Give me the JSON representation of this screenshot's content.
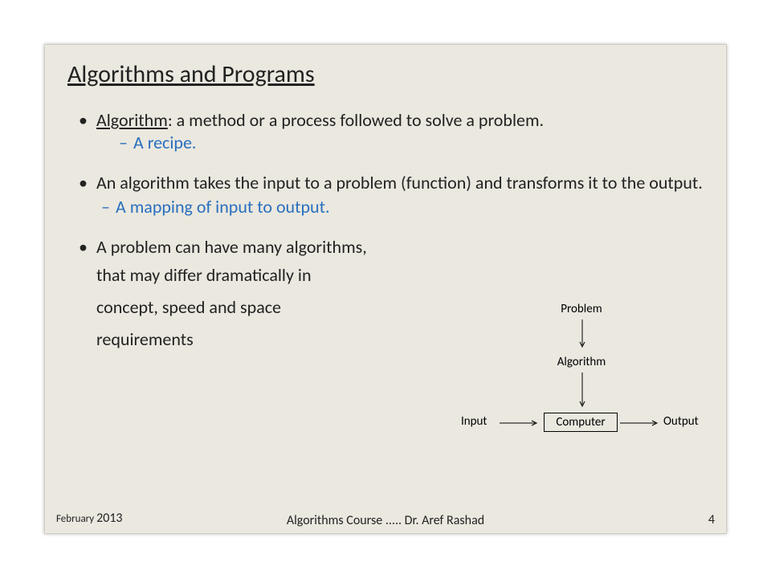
{
  "title": "Algorithms and Programs",
  "bullets": {
    "b1_term": "Algorithm",
    "b1_rest": ": a method or a process followed to solve a problem.",
    "s1": "A recipe.",
    "b2": "An algorithm takes the input to a problem (function) and transforms it to the output.",
    "s2": "A mapping of input to output.",
    "b3": "A problem can have many algorithms,",
    "c1": "that may differ dramatically in",
    "c2": "concept, speed and space",
    "c3": " requirements"
  },
  "diagram": {
    "problem": "Problem",
    "algorithm": "Algorithm",
    "input": "Input",
    "computer": "Computer",
    "output": "Output"
  },
  "footer": {
    "month": "February ",
    "year": "2013",
    "center": "Algorithms Course .....   Dr. Aref Rashad",
    "page": "4"
  }
}
